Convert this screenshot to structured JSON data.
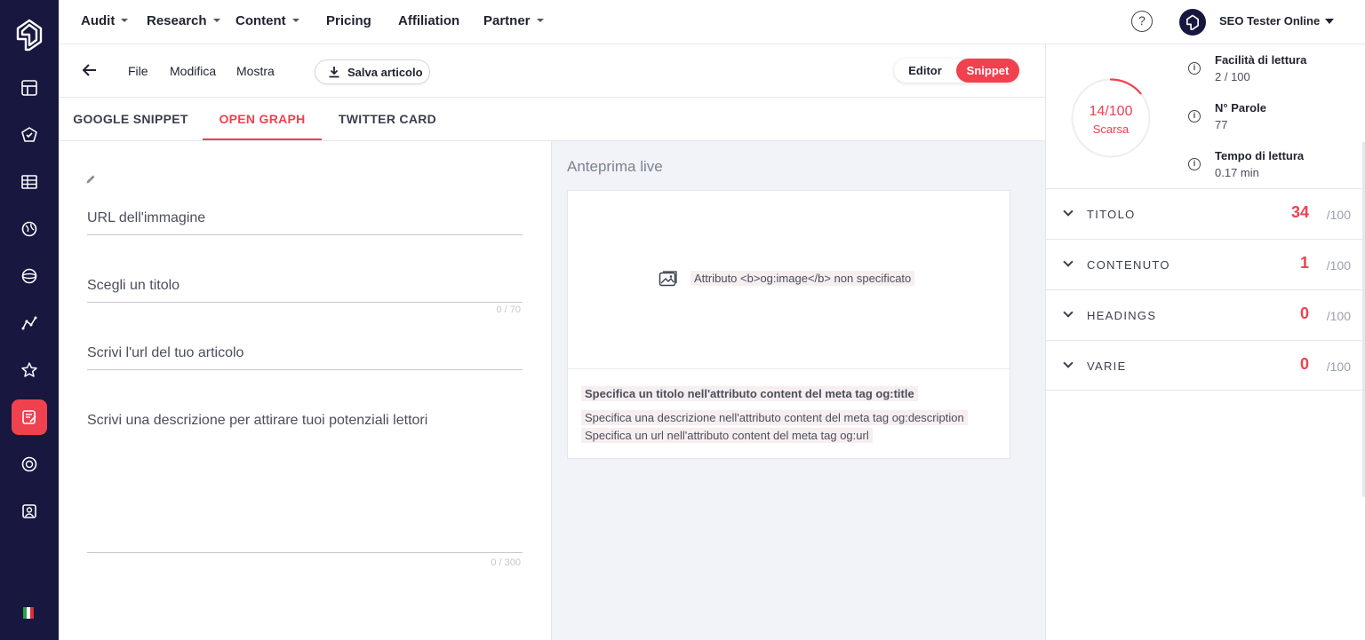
{
  "nav": {
    "top_menu": [
      {
        "label": "Audit",
        "has_dropdown": true
      },
      {
        "label": "Research",
        "has_dropdown": true
      },
      {
        "label": "Content",
        "has_dropdown": true
      },
      {
        "label": "Pricing",
        "has_dropdown": false
      },
      {
        "label": "Affiliation",
        "has_dropdown": false
      },
      {
        "label": "Partner",
        "has_dropdown": true
      }
    ],
    "help_label": "?",
    "account_name": "SEO Tester Online"
  },
  "sidebar": {
    "icons": [
      "dashboard-icon",
      "audit-icon",
      "table-icon",
      "globe-icon",
      "planet-icon",
      "analytics-icon",
      "star-icon",
      "content-editor-icon",
      "support-icon",
      "account-icon"
    ],
    "active_index": 7,
    "language_flag": "italian-flag"
  },
  "toolbar": {
    "menus": [
      "File",
      "Modifica",
      "Mostra"
    ],
    "save_label": "Salva articolo",
    "mode_editor": "Editor",
    "mode_snippet": "Snippet",
    "active_mode": "Snippet"
  },
  "tabs": [
    {
      "label": "GOOGLE SNIPPET",
      "active": false
    },
    {
      "label": "OPEN GRAPH",
      "active": true
    },
    {
      "label": "TWITTER CARD",
      "active": false
    }
  ],
  "form": {
    "image_url_placeholder": "URL dell'immagine",
    "title_placeholder": "Scegli un titolo",
    "title_counter": "0 / 70",
    "url_placeholder": "Scrivi l'url del tuo articolo",
    "description_placeholder": "Scrivi una descrizione per attirare tuoi potenziali lettori",
    "description_counter": "0 / 300"
  },
  "preview": {
    "title": "Anteprima live",
    "image_warning": "Attributo <b>og:image</b> non specificato",
    "title_warning": "Specifica un titolo nell'attributo content del meta tag og:title",
    "description_warning": "Specifica una descrizione nell'attributo content del meta tag og:description",
    "url_warning": "Specifica un url nell'attributo content del meta tag og:url"
  },
  "score": {
    "value": "14/100",
    "label": "Scarsa",
    "fraction": 0.14,
    "metrics": [
      {
        "label": "Facilità di lettura",
        "value": "2 / 100"
      },
      {
        "label": "N° Parole",
        "value": "77"
      },
      {
        "label": "Tempo di lettura",
        "value": "0.17 min"
      }
    ],
    "sections": [
      {
        "name": "TITOLO",
        "score": "34",
        "max": "/100"
      },
      {
        "name": "CONTENUTO",
        "score": "1",
        "max": "/100"
      },
      {
        "name": "HEADINGS",
        "score": "0",
        "max": "/100"
      },
      {
        "name": "VARIE",
        "score": "0",
        "max": "/100"
      }
    ]
  },
  "colors": {
    "accent": "#f0414f",
    "sidebar_bg": "#17173f",
    "preview_bg": "#f1f3f8"
  }
}
